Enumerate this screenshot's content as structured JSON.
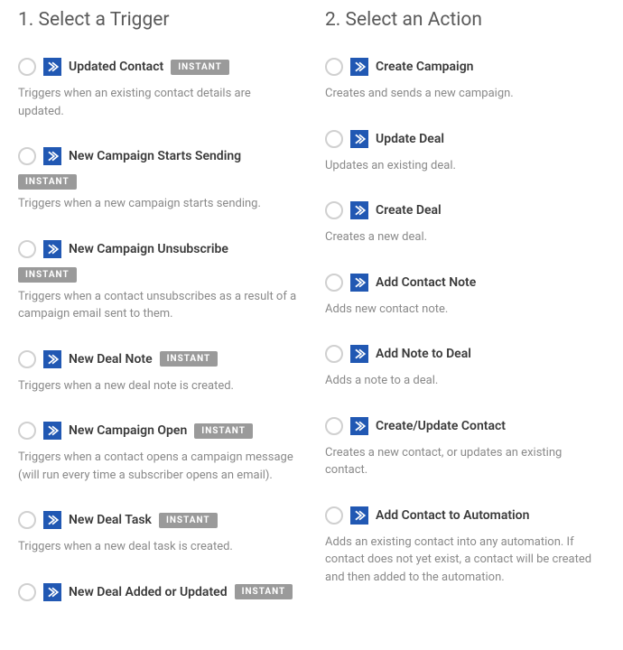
{
  "badge_label": "INSTANT",
  "columns": [
    {
      "heading": "1. Select a Trigger",
      "items": [
        {
          "title": "Updated Contact",
          "desc": "Triggers when an existing contact details are updated.",
          "instant": true,
          "badgeInline": true
        },
        {
          "title": "New Campaign Starts Sending",
          "desc": "Triggers when a new campaign starts sending.",
          "instant": true,
          "badgeInline": false
        },
        {
          "title": "New Campaign Unsubscribe",
          "desc": "Triggers when a contact unsubscribes as a result of a campaign email sent to them.",
          "instant": true,
          "badgeInline": false
        },
        {
          "title": "New Deal Note",
          "desc": "Triggers when a new deal note is created.",
          "instant": true,
          "badgeInline": true
        },
        {
          "title": "New Campaign Open",
          "desc": "Triggers when a contact opens a campaign message (will run every time a subscriber opens an email).",
          "instant": true,
          "badgeInline": true
        },
        {
          "title": "New Deal Task",
          "desc": "Triggers when a new deal task is created.",
          "instant": true,
          "badgeInline": true
        },
        {
          "title": "New Deal Added or Updated",
          "desc": "",
          "instant": true,
          "badgeInline": true
        }
      ]
    },
    {
      "heading": "2. Select an Action",
      "items": [
        {
          "title": "Create Campaign",
          "desc": "Creates and sends a new campaign.",
          "instant": false
        },
        {
          "title": "Update Deal",
          "desc": "Updates an existing deal.",
          "instant": false
        },
        {
          "title": "Create Deal",
          "desc": "Creates a new deal.",
          "instant": false
        },
        {
          "title": "Add Contact Note",
          "desc": "Adds new contact note.",
          "instant": false
        },
        {
          "title": "Add Note to Deal",
          "desc": "Adds a note to a deal.",
          "instant": false
        },
        {
          "title": "Create/Update Contact",
          "desc": "Creates a new contact, or updates an existing contact.",
          "instant": false
        },
        {
          "title": "Add Contact to Automation",
          "desc": "Adds an existing contact into any automation. If contact does not yet exist, a contact will be created and then added to the automation.",
          "instant": false
        }
      ]
    }
  ]
}
